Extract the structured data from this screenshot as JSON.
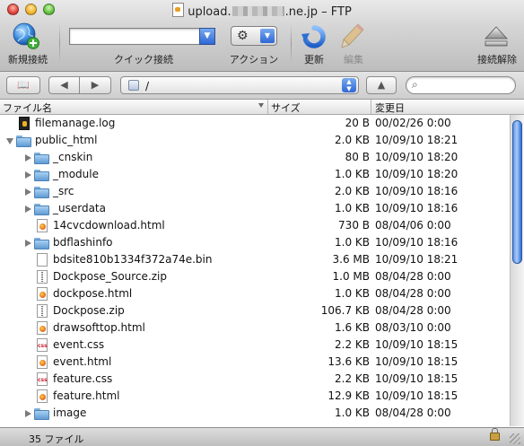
{
  "window": {
    "title_prefix": "upload.",
    "title_suffix": ".ne.jp – FTP"
  },
  "toolbar": {
    "new_connection": "新規接続",
    "quick_connect": "クイック接続",
    "quick_connect_value": "",
    "action": "アクション",
    "refresh": "更新",
    "edit": "編集",
    "disconnect": "接続解除"
  },
  "navbar": {
    "path": "/",
    "search_placeholder": ""
  },
  "columns": {
    "name": "ファイル名",
    "size": "サイズ",
    "modified": "変更日"
  },
  "files": [
    {
      "name": "filemanage.log",
      "size": "20 B",
      "date": "00/02/26 0:00",
      "kind": "log",
      "depth": 0
    },
    {
      "name": "public_html",
      "size": "2.0 KB",
      "date": "10/09/10 18:21",
      "kind": "folder",
      "depth": 0,
      "expanded": true
    },
    {
      "name": "_cnskin",
      "size": "80 B",
      "date": "10/09/10 18:20",
      "kind": "folder",
      "depth": 1
    },
    {
      "name": "_module",
      "size": "1.0 KB",
      "date": "10/09/10 18:20",
      "kind": "folder",
      "depth": 1
    },
    {
      "name": "_src",
      "size": "2.0 KB",
      "date": "10/09/10 18:16",
      "kind": "folder",
      "depth": 1
    },
    {
      "name": "_userdata",
      "size": "1.0 KB",
      "date": "10/09/10 18:16",
      "kind": "folder",
      "depth": 1
    },
    {
      "name": "14cvcdownload.html",
      "size": "730 B",
      "date": "08/04/06 0:00",
      "kind": "html",
      "depth": 1
    },
    {
      "name": "bdflashinfo",
      "size": "1.0 KB",
      "date": "10/09/10 18:16",
      "kind": "folder",
      "depth": 1
    },
    {
      "name": "bdsite810b1334f372a74e.bin",
      "size": "3.6 MB",
      "date": "10/09/10 18:21",
      "kind": "file",
      "depth": 1
    },
    {
      "name": "Dockpose_Source.zip",
      "size": "1.0 MB",
      "date": "08/04/28 0:00",
      "kind": "zip",
      "depth": 1
    },
    {
      "name": "dockpose.html",
      "size": "1.0 KB",
      "date": "08/04/28 0:00",
      "kind": "html",
      "depth": 1
    },
    {
      "name": "Dockpose.zip",
      "size": "106.7 KB",
      "date": "08/04/28 0:00",
      "kind": "zip",
      "depth": 1
    },
    {
      "name": "drawsofttop.html",
      "size": "1.6 KB",
      "date": "08/03/10 0:00",
      "kind": "html",
      "depth": 1
    },
    {
      "name": "event.css",
      "size": "2.2 KB",
      "date": "10/09/10 18:15",
      "kind": "css",
      "depth": 1
    },
    {
      "name": "event.html",
      "size": "13.6 KB",
      "date": "10/09/10 18:15",
      "kind": "html",
      "depth": 1
    },
    {
      "name": "feature.css",
      "size": "2.2 KB",
      "date": "10/09/10 18:15",
      "kind": "css",
      "depth": 1
    },
    {
      "name": "feature.html",
      "size": "12.9 KB",
      "date": "10/09/10 18:15",
      "kind": "html",
      "depth": 1
    },
    {
      "name": "image",
      "size": "1.0 KB",
      "date": "08/04/28 0:00",
      "kind": "folder",
      "depth": 1
    }
  ],
  "status": {
    "count": "35 ファイル"
  }
}
